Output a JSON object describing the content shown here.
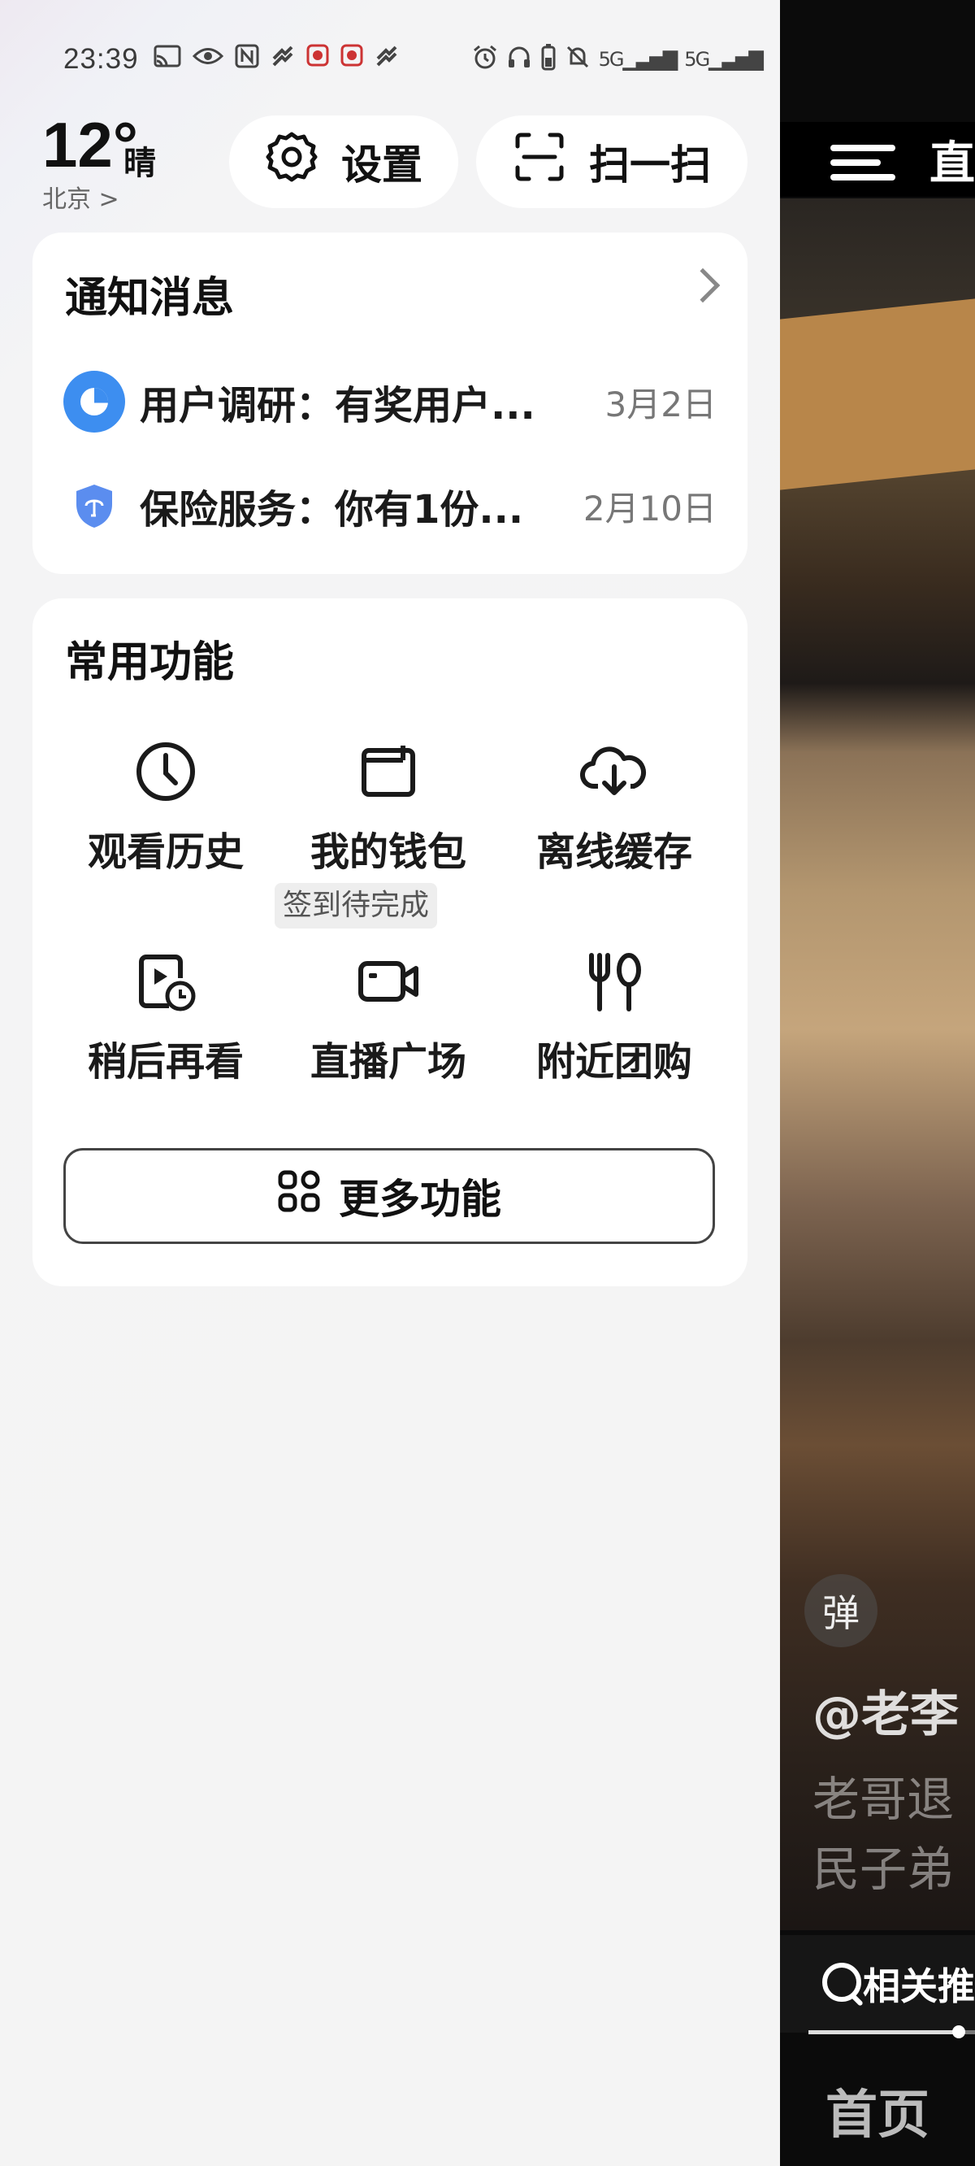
{
  "status_bar": {
    "time": "23:39",
    "left_icons": [
      "cast-icon",
      "eye-icon",
      "nfc-icon",
      "app-icon",
      "app-icon",
      "app-icon",
      "app-icon"
    ],
    "right_icons": [
      "alarm-icon",
      "headphones-icon",
      "battery-icon",
      "mute-icon",
      "signal-icon",
      "signal-icon"
    ],
    "network_label_1": "5G",
    "network_label_2": "5G"
  },
  "weather": {
    "temperature": "12°",
    "condition": "晴",
    "city": "北京 >"
  },
  "header_buttons": {
    "settings_label": "设置",
    "scan_label": "扫一扫"
  },
  "notifications": {
    "title": "通知消息",
    "items": [
      {
        "text": "用户调研：有奖用户...",
        "date": "3月2日",
        "icon": "survey-icon"
      },
      {
        "text": "保险服务：你有1份...",
        "date": "2月10日",
        "icon": "shield-icon"
      }
    ]
  },
  "functions": {
    "title": "常用功能",
    "items": [
      {
        "label": "观看历史",
        "icon": "clock-icon"
      },
      {
        "label": "我的钱包",
        "icon": "wallet-icon"
      },
      {
        "label": "离线缓存",
        "icon": "cloud-download-icon"
      },
      {
        "label": "稍后再看",
        "icon": "watch-later-icon"
      },
      {
        "label": "直播广场",
        "icon": "video-camera-icon"
      },
      {
        "label": "附近团购",
        "icon": "fork-spoon-icon"
      }
    ],
    "wallet_badge": "签到待完成",
    "more_label": "更多功能"
  },
  "background_app": {
    "top_text": "直",
    "danmu_label": "弹",
    "author": "@老李",
    "desc_line_1": "老哥退",
    "desc_line_2": "民子弟",
    "search_text": "相关推",
    "progress": 0.9,
    "tab_label": "首页"
  },
  "colors": {
    "survey_icon_bg": "#3d8ef0",
    "shield_icon": "#5b8def"
  }
}
